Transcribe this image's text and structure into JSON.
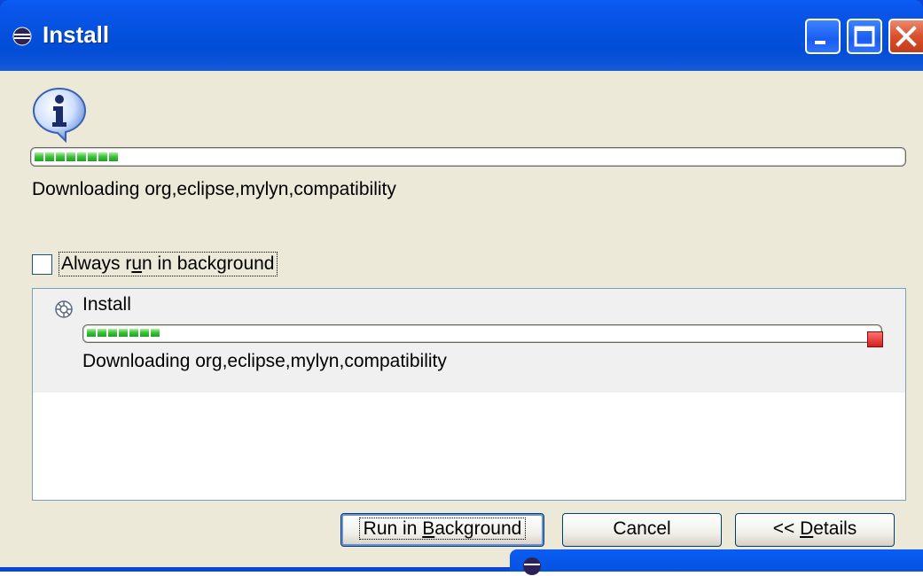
{
  "window": {
    "title": "Install",
    "controls": [
      "minimize",
      "maximize",
      "close"
    ]
  },
  "dialog": {
    "info_icon": "information-icon",
    "progress": {
      "value": 0.1
    },
    "status_text": "Downloading org,eclipse,mylyn,compatibility",
    "always_background": {
      "checked": false,
      "label_before": "Always r",
      "label_mnemonic": "u",
      "label_after": "n in background"
    }
  },
  "jobs": [
    {
      "name": "Install",
      "icon": "install-job-icon",
      "progress": 0.1,
      "status": "Downloading org,eclipse,mylyn,compatibility",
      "stop_icon": "stop-icon"
    }
  ],
  "buttons": {
    "run_in_background": {
      "before": "Run in ",
      "mnemonic": "B",
      "after": "ackground"
    },
    "cancel": "Cancel",
    "details": {
      "before": "<< ",
      "mnemonic": "D",
      "after": "etails"
    }
  },
  "colors": {
    "titlebar": "#0552e0",
    "dialog_bg": "#ece9d8",
    "progress_fill": "#3ec43e",
    "stop": "#d42020"
  }
}
